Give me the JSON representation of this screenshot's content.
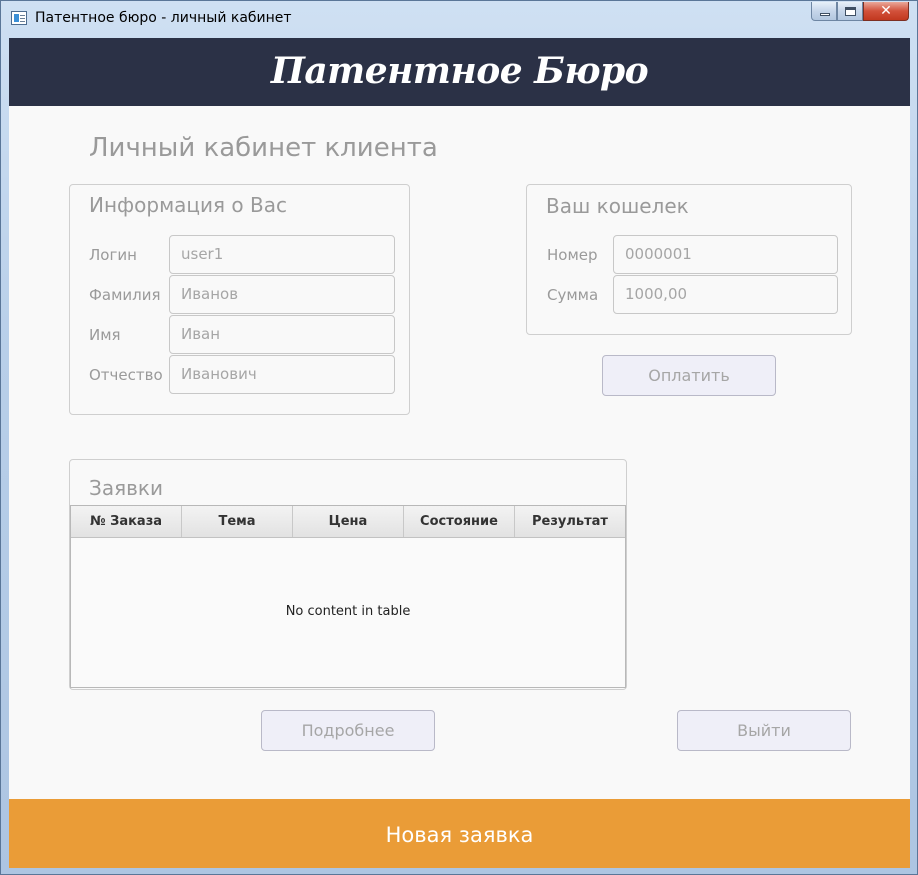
{
  "window": {
    "title": "Патентное бюро - личный кабинет",
    "close_glyph": "✕"
  },
  "header": {
    "brand": "Патентное Бюро"
  },
  "page": {
    "title": "Личный кабинет клиента"
  },
  "info_panel": {
    "title": "Информация о Вас",
    "fields": [
      {
        "label": "Логин",
        "value": "user1"
      },
      {
        "label": "Фамилия",
        "value": "Иванов"
      },
      {
        "label": "Имя",
        "value": "Иван"
      },
      {
        "label": "Отчество",
        "value": "Иванович"
      }
    ]
  },
  "wallet_panel": {
    "title": "Ваш кошелек",
    "fields": [
      {
        "label": "Номер",
        "value": "0000001"
      },
      {
        "label": "Сумма",
        "value": "1000,00"
      }
    ],
    "pay_button": "Оплатить"
  },
  "orders": {
    "title": "Заявки",
    "columns": [
      "№ Заказа",
      "Тема",
      "Цена",
      "Состояние",
      "Результат"
    ],
    "rows": [],
    "empty_message": "No content in table"
  },
  "buttons": {
    "details": "Подробнее",
    "logout": "Выйти",
    "new_request": "Новая заявка"
  },
  "colors": {
    "header_bg": "#2b3146",
    "footer_bg": "#ea9c37",
    "muted_text": "#9a9a9a"
  }
}
